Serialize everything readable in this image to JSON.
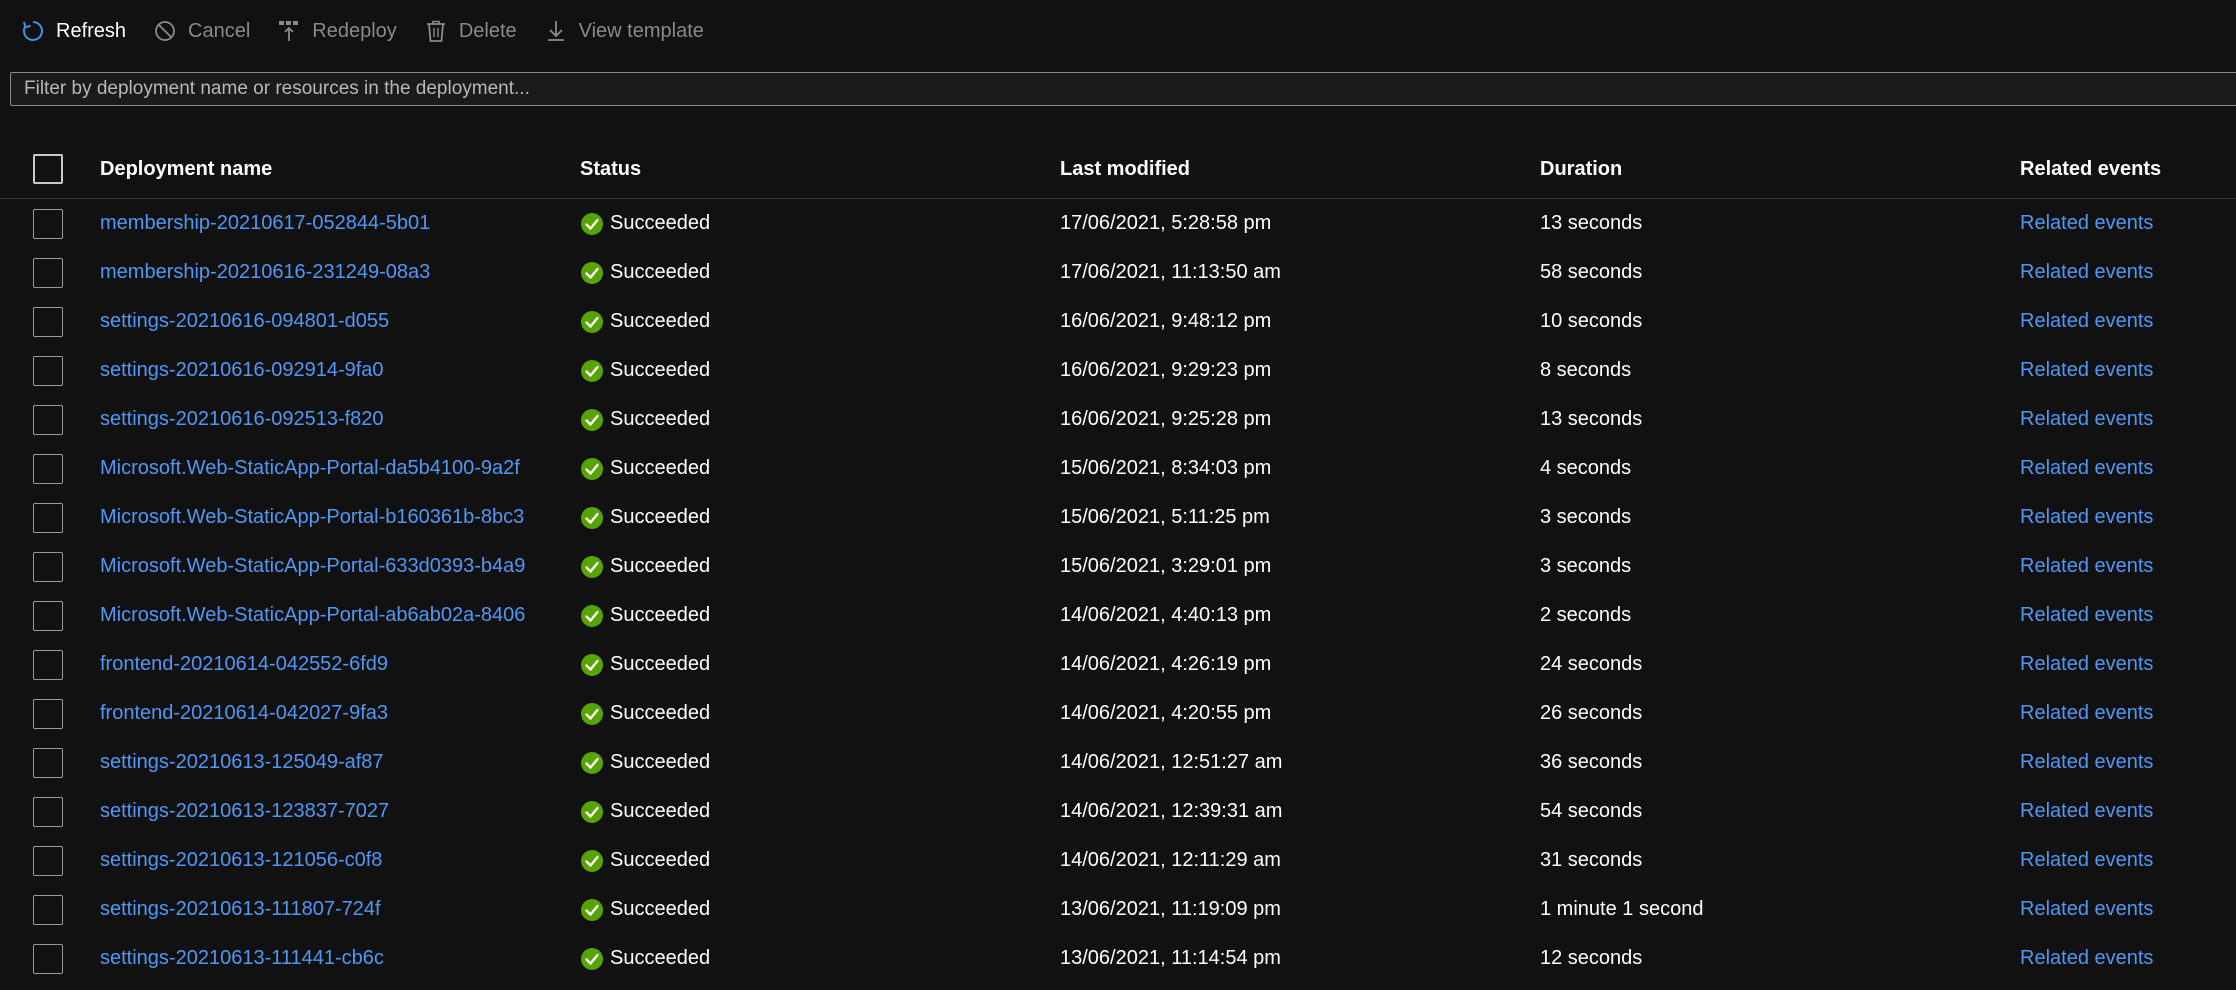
{
  "toolbar": {
    "refresh": "Refresh",
    "cancel": "Cancel",
    "redeploy": "Redeploy",
    "delete": "Delete",
    "view_template": "View template"
  },
  "filter": {
    "placeholder": "Filter by deployment name or resources in the deployment..."
  },
  "table": {
    "columns": {
      "name": "Deployment name",
      "status": "Status",
      "modified": "Last modified",
      "duration": "Duration",
      "events": "Related events"
    },
    "rows": [
      {
        "name": "membership-20210617-052844-5b01",
        "status": "Succeeded",
        "modified": "17/06/2021, 5:28:58 pm",
        "duration": "13 seconds",
        "events": "Related events"
      },
      {
        "name": "membership-20210616-231249-08a3",
        "status": "Succeeded",
        "modified": "17/06/2021, 11:13:50 am",
        "duration": "58 seconds",
        "events": "Related events"
      },
      {
        "name": "settings-20210616-094801-d055",
        "status": "Succeeded",
        "modified": "16/06/2021, 9:48:12 pm",
        "duration": "10 seconds",
        "events": "Related events"
      },
      {
        "name": "settings-20210616-092914-9fa0",
        "status": "Succeeded",
        "modified": "16/06/2021, 9:29:23 pm",
        "duration": "8 seconds",
        "events": "Related events"
      },
      {
        "name": "settings-20210616-092513-f820",
        "status": "Succeeded",
        "modified": "16/06/2021, 9:25:28 pm",
        "duration": "13 seconds",
        "events": "Related events"
      },
      {
        "name": "Microsoft.Web-StaticApp-Portal-da5b4100-9a2f",
        "status": "Succeeded",
        "modified": "15/06/2021, 8:34:03 pm",
        "duration": "4 seconds",
        "events": "Related events"
      },
      {
        "name": "Microsoft.Web-StaticApp-Portal-b160361b-8bc3",
        "status": "Succeeded",
        "modified": "15/06/2021, 5:11:25 pm",
        "duration": "3 seconds",
        "events": "Related events"
      },
      {
        "name": "Microsoft.Web-StaticApp-Portal-633d0393-b4a9",
        "status": "Succeeded",
        "modified": "15/06/2021, 3:29:01 pm",
        "duration": "3 seconds",
        "events": "Related events"
      },
      {
        "name": "Microsoft.Web-StaticApp-Portal-ab6ab02a-8406",
        "status": "Succeeded",
        "modified": "14/06/2021, 4:40:13 pm",
        "duration": "2 seconds",
        "events": "Related events"
      },
      {
        "name": "frontend-20210614-042552-6fd9",
        "status": "Succeeded",
        "modified": "14/06/2021, 4:26:19 pm",
        "duration": "24 seconds",
        "events": "Related events"
      },
      {
        "name": "frontend-20210614-042027-9fa3",
        "status": "Succeeded",
        "modified": "14/06/2021, 4:20:55 pm",
        "duration": "26 seconds",
        "events": "Related events"
      },
      {
        "name": "settings-20210613-125049-af87",
        "status": "Succeeded",
        "modified": "14/06/2021, 12:51:27 am",
        "duration": "36 seconds",
        "events": "Related events"
      },
      {
        "name": "settings-20210613-123837-7027",
        "status": "Succeeded",
        "modified": "14/06/2021, 12:39:31 am",
        "duration": "54 seconds",
        "events": "Related events"
      },
      {
        "name": "settings-20210613-121056-c0f8",
        "status": "Succeeded",
        "modified": "14/06/2021, 12:11:29 am",
        "duration": "31 seconds",
        "events": "Related events"
      },
      {
        "name": "settings-20210613-111807-724f",
        "status": "Succeeded",
        "modified": "13/06/2021, 11:19:09 pm",
        "duration": "1 minute 1 second",
        "events": "Related events"
      },
      {
        "name": "settings-20210613-111441-cb6c",
        "status": "Succeeded",
        "modified": "13/06/2021, 11:14:54 pm",
        "duration": "12 seconds",
        "events": "Related events"
      }
    ]
  },
  "colors": {
    "background": "#111111",
    "link": "#4f98f5",
    "success": "#57a300",
    "accent": "#3a96dd"
  },
  "icons": {
    "refresh": "refresh-icon",
    "cancel": "cancel-icon",
    "redeploy": "redeploy-icon",
    "delete": "delete-icon",
    "view_template": "download-icon",
    "status": "success-check-icon"
  }
}
